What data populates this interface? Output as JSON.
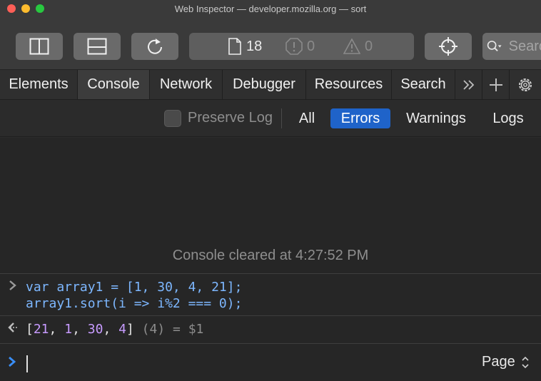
{
  "window": {
    "title": "Web Inspector — developer.mozilla.org — sort"
  },
  "toolbar": {
    "resources_count": "18",
    "errors_count": "0",
    "warnings_count": "0",
    "search_placeholder": "Search"
  },
  "tabs": [
    {
      "label": "Elements"
    },
    {
      "label": "Console"
    },
    {
      "label": "Network"
    },
    {
      "label": "Debugger"
    },
    {
      "label": "Resources"
    },
    {
      "label": "Search"
    }
  ],
  "filters": {
    "preserve_log": "Preserve Log",
    "all": "All",
    "errors": "Errors",
    "warnings": "Warnings",
    "logs": "Logs"
  },
  "console": {
    "cleared_message": "Console cleared at 4:27:52 PM",
    "input_line1": "var array1 = [1, 30, 4, 21];",
    "input_line2": "array1.sort(i => i%2 === 0);",
    "result": {
      "open": "[",
      "v1": "21",
      "v2": "1",
      "v3": "30",
      "v4": "4",
      "close": "]",
      "length": "(4)",
      "assign": "= $1"
    },
    "context": "Page"
  },
  "colors": {
    "accent": "#1f63c9",
    "prompt": "#3a8ef6",
    "code": "#7db7ff",
    "number": "#c79bff"
  }
}
